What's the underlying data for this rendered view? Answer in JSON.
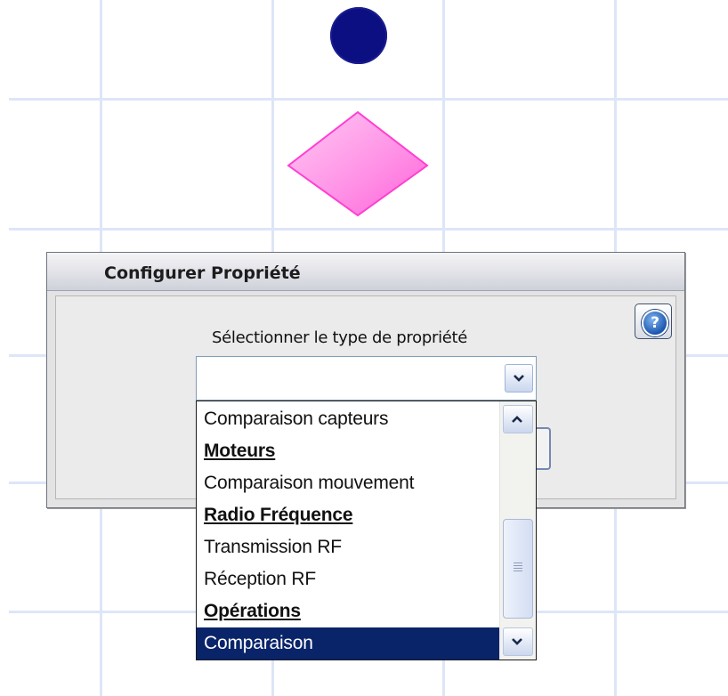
{
  "dialog": {
    "title": "Configurer Propriété",
    "label": "Sélectionner le type de propriété",
    "help_icon_glyph": "?"
  },
  "combo": {
    "value": ""
  },
  "dropdown": {
    "items": [
      {
        "label": "Comparaison capteurs",
        "kind": "option"
      },
      {
        "label": "Moteurs",
        "kind": "group"
      },
      {
        "label": "Comparaison mouvement",
        "kind": "option"
      },
      {
        "label": "Radio Fréquence",
        "kind": "group"
      },
      {
        "label": "Transmission RF",
        "kind": "option"
      },
      {
        "label": "Réception RF",
        "kind": "option"
      },
      {
        "label": "Opérations",
        "kind": "group"
      },
      {
        "label": "Comparaison",
        "kind": "option",
        "selected": true
      }
    ]
  },
  "colors": {
    "selection": "#0a246a",
    "circle": "#0c0f82",
    "diamond": "#ff7ae0",
    "grid": "#dde6f7"
  },
  "icons": [
    "help-icon",
    "chevron-down-icon",
    "chevron-up-icon"
  ]
}
